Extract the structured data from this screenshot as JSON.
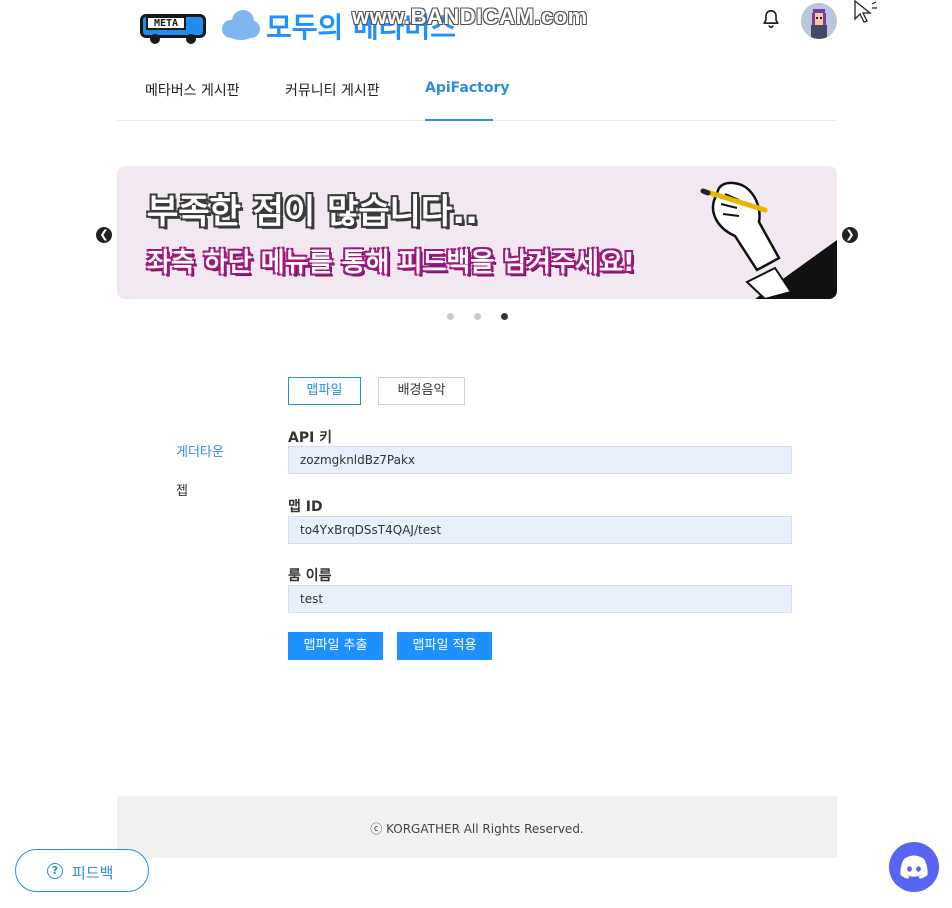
{
  "header": {
    "logo_label": "META",
    "brand_title": "모두의 메타버스",
    "watermark": "www.BANDICAM.com"
  },
  "tabs": [
    {
      "label": "메타버스 게시판"
    },
    {
      "label": "커뮤니티 게시판"
    },
    {
      "label": "ApiFactory",
      "active": true
    }
  ],
  "banner": {
    "line1": "부족한 점이 많습니다..",
    "line2": "좌측 하단 메뉴를 통해 피드백을 남겨주세요!",
    "dots": 3,
    "active_dot_index": 2
  },
  "sidebar": {
    "items": [
      {
        "label": "게더타운",
        "active": true
      },
      {
        "label": "젭",
        "active": false
      }
    ]
  },
  "form": {
    "segments": [
      {
        "label": "맵파일",
        "active": true
      },
      {
        "label": "배경음악",
        "active": false
      }
    ],
    "api_key": {
      "label": "API 키",
      "value": "zozmgknldBz7Pakx"
    },
    "map_id": {
      "label": "맵 ID",
      "value": "to4YxBrqDSsT4QAJ/test"
    },
    "room_name": {
      "label": "룸 이름",
      "value": "test"
    },
    "extract_button": "맵파일 추출",
    "apply_button": "맵파일 적용"
  },
  "footer": {
    "copyright": "ⓒ KORGATHER All Rights Reserved."
  },
  "feedback": {
    "icon_glyph": "?",
    "label": "피드백"
  },
  "colors": {
    "accent": "#2a8ce3",
    "primary_button": "#1e90ff",
    "discord": "#5865f2",
    "input_bg": "#e8f0fb"
  }
}
